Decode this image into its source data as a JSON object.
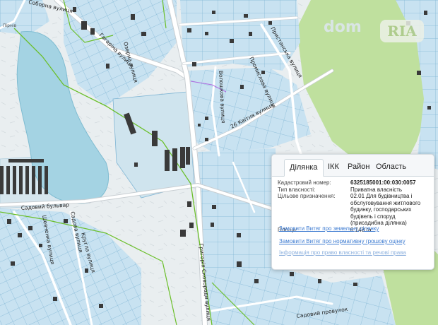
{
  "map": {
    "streets": [
      "Григорія Сковороди вулиця",
      "Волошкова вулиця",
      "26 Квітня вулиця",
      "Садовий бульвар",
      "Гагаріна вулиця",
      "Пристанська вулиця",
      "Промислова вулиця",
      "Соборна вулиця",
      "Садова вулиця",
      "Шевченка вулиця",
      "Кругла вулиця",
      "Озерна вулиця",
      "Садовий провулок"
    ],
    "corner_label": "Пірнів",
    "colors": {
      "parcel": "#c5e1f0",
      "water": "#a7d4e3",
      "green": "#b8dc95",
      "road": "#ffffff",
      "building": "#3a3a3a",
      "boundary_green": "#6bbf2a",
      "boundary_purple": "#b06be0"
    }
  },
  "watermark": {
    "text": "dom",
    "badge": "RIA"
  },
  "info_panel": {
    "tabs": [
      {
        "label": "Ділянка",
        "active": true
      },
      {
        "label": "ІКК",
        "active": false
      },
      {
        "label": "Район",
        "active": false
      },
      {
        "label": "Область",
        "active": false
      }
    ],
    "fields": [
      {
        "key": "Кадастровий номер:",
        "value": "6325185001:00:030:0057"
      },
      {
        "key": "Тип власності:",
        "value": "Приватна власність"
      },
      {
        "key": "Цільове призначення:",
        "value": "02.01 Для будівництва і обслуговування житлового будинку, господарських будівель і споруд (присадибна ділянка)"
      },
      {
        "key": "Площа:",
        "value": "0.148 га"
      }
    ],
    "links": [
      "Замовити Витяг про земельну ділянку",
      "Замовити Витяг про нормативну грошову оцінку",
      "Інформація про право власності та речові права"
    ]
  }
}
